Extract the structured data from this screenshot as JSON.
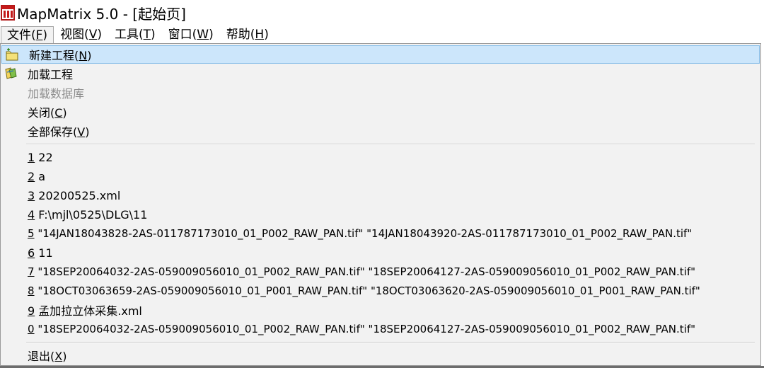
{
  "window": {
    "title": "MapMatrix 5.0 - [起始页]"
  },
  "menubar": [
    {
      "text": "文件(",
      "mnemonic": "F",
      "close": ")",
      "active": true
    },
    {
      "text": "视图(",
      "mnemonic": "V",
      "close": ")"
    },
    {
      "text": "工具(",
      "mnemonic": "T",
      "close": ")"
    },
    {
      "text": "窗口(",
      "mnemonic": "W",
      "close": ")"
    },
    {
      "text": "帮助(",
      "mnemonic": "H",
      "close": ")"
    }
  ],
  "file_menu": {
    "new_project": {
      "text": "新建工程(",
      "mnemonic": "N",
      "close": ")"
    },
    "load_project": {
      "text": "加载工程"
    },
    "load_database": {
      "text": "加载数据库"
    },
    "close": {
      "text": "关闭(",
      "mnemonic": "C",
      "close": ")"
    },
    "save_all": {
      "text": "全部保存(",
      "mnemonic": "V",
      "close": ")"
    },
    "recent_files": [
      {
        "num": "1",
        "text": " 22"
      },
      {
        "num": "2",
        "text": " a"
      },
      {
        "num": "3",
        "text": " 20200525.xml"
      },
      {
        "num": "4",
        "text": " F:\\mjl\\0525\\DLG\\11"
      },
      {
        "num": "5",
        "text": " \"14JAN18043828-2AS-011787173010_01_P002_RAW_PAN.tif\" \"14JAN18043920-2AS-011787173010_01_P002_RAW_PAN.tif\""
      },
      {
        "num": "6",
        "text": " 11"
      },
      {
        "num": "7",
        "text": " \"18SEP20064032-2AS-059009056010_01_P002_RAW_PAN.tif\" \"18SEP20064127-2AS-059009056010_01_P002_RAW_PAN.tif\""
      },
      {
        "num": "8",
        "text": " \"18OCT03063659-2AS-059009056010_01_P001_RAW_PAN.tif\" \"18OCT03063620-2AS-059009056010_01_P001_RAW_PAN.tif\""
      },
      {
        "num": "9",
        "text": " 孟加拉立体采集.xml"
      },
      {
        "num": "0",
        "text": " \"18SEP20064032-2AS-059009056010_01_P002_RAW_PAN.tif\" \"18SEP20064127-2AS-059009056010_01_P002_RAW_PAN.tif\""
      }
    ],
    "exit": {
      "text": "退出(",
      "mnemonic": "X",
      "close": ")"
    }
  },
  "icons": {
    "app": "mapmatrix-app-icon",
    "new_project": "folder-new-icon",
    "load_project": "open-project-icon"
  },
  "colors": {
    "highlight_bg": "#cce6fb",
    "highlight_border": "#86bde8",
    "menu_bg": "#f2f2f2",
    "disabled_text": "#8d8d8d"
  }
}
